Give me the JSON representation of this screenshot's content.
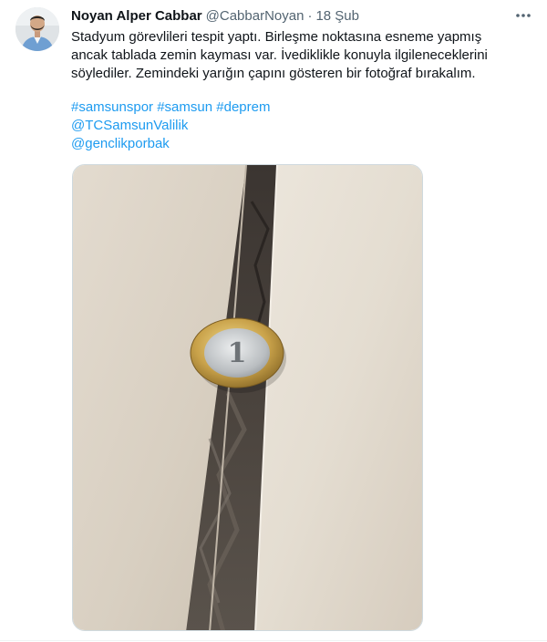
{
  "author": {
    "display_name": "Noyan Alper Cabbar",
    "handle": "@CabbarNoyan",
    "separator": "·",
    "date": "18 Şub"
  },
  "tweet": {
    "lines": [
      "Stadyum görevlileri tespit yaptı. Birleşme noktasına esneme yapmış",
      "ancak tablada zemin kayması var. İvedikliklе konuyla ilgileneceklerini",
      "söylediler. Zemindeki yarığın çapını gösteren bir fotoğraf bırakalım."
    ],
    "hashtags": [
      "#samsunspor",
      "#samsun",
      "#deprem"
    ],
    "mentions": [
      "@TCSamsunValilik",
      "@genclikporbak"
    ]
  },
  "icons": {
    "more": "more-horizontal-icon",
    "avatar": "user-avatar"
  },
  "colors": {
    "text": "#0f1419",
    "secondary": "#536471",
    "link": "#1d9bf0",
    "border": "#cfd9de"
  },
  "media": {
    "type": "photo",
    "subject": "coin-in-floor-crack"
  }
}
